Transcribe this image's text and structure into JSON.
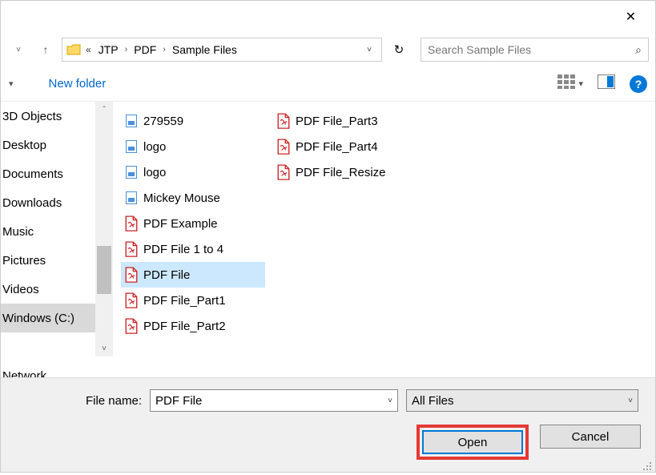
{
  "titlebar": {
    "close_icon": "✕"
  },
  "nav": {
    "up_icon": "↑",
    "breadcrumb": [
      "JTP",
      "PDF",
      "Sample Files"
    ],
    "breadcrumb_prefix": "«",
    "dropdown_icon": "˅",
    "refresh_icon": "↻",
    "search_placeholder": "Search Sample Files",
    "search_icon": "⌕"
  },
  "toolbar": {
    "dropdown_icon": "▾",
    "new_folder": "New folder",
    "view_dropdown": "▾",
    "help_icon": "?"
  },
  "sidebar": {
    "items": [
      "3D Objects",
      "Desktop",
      "Documents",
      "Downloads",
      "Music",
      "Pictures",
      "Videos",
      "Windows (C:)",
      "",
      "Network"
    ],
    "selected_index": 7
  },
  "files": {
    "col1": [
      {
        "name": "279559",
        "type": "img"
      },
      {
        "name": "logo",
        "type": "img"
      },
      {
        "name": "logo",
        "type": "img"
      },
      {
        "name": "Mickey Mouse",
        "type": "img"
      },
      {
        "name": "PDF Example",
        "type": "pdf"
      },
      {
        "name": "PDF File 1 to 4",
        "type": "pdf"
      },
      {
        "name": "PDF File",
        "type": "pdf",
        "selected": true
      },
      {
        "name": "PDF File_Part1",
        "type": "pdf"
      },
      {
        "name": "PDF File_Part2",
        "type": "pdf"
      }
    ],
    "col2": [
      {
        "name": "PDF File_Part3",
        "type": "pdf"
      },
      {
        "name": "PDF File_Part4",
        "type": "pdf"
      },
      {
        "name": "PDF File_Resize",
        "type": "pdf"
      }
    ]
  },
  "bottom": {
    "filename_label": "File name:",
    "filename_value": "PDF File",
    "filter_label": "All Files",
    "open_label": "Open",
    "cancel_label": "Cancel"
  }
}
